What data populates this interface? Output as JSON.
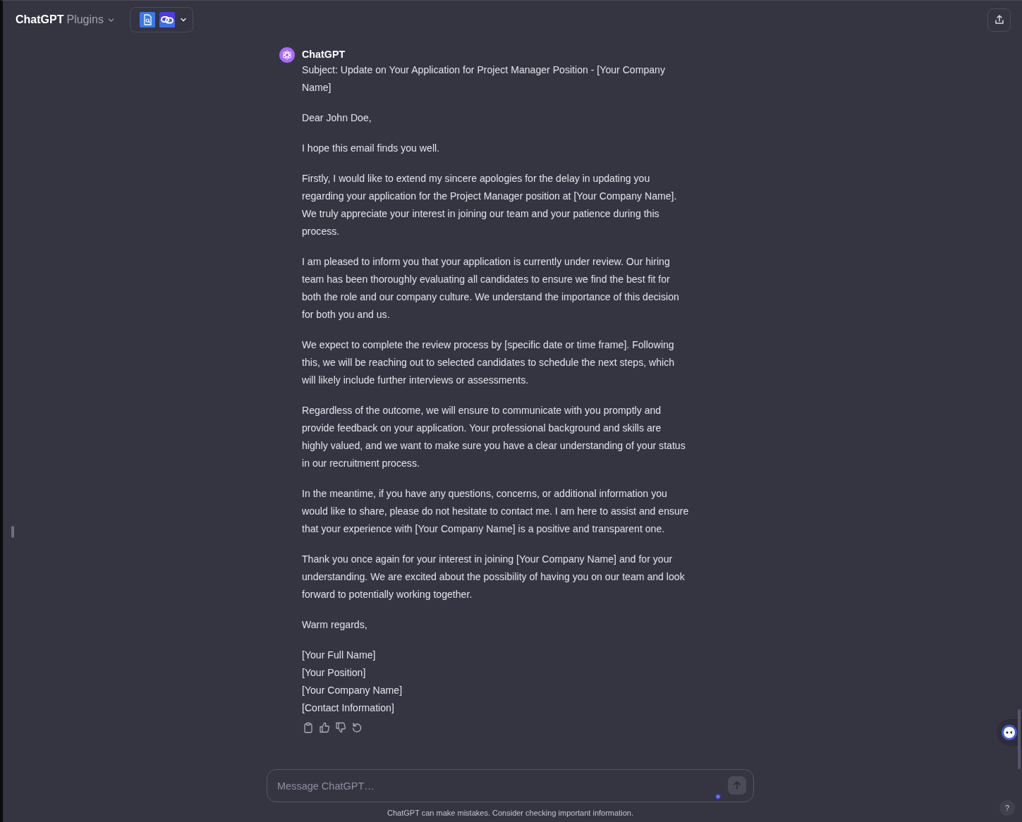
{
  "header": {
    "title": "ChatGPT",
    "model": "Plugins"
  },
  "message": {
    "author": "ChatGPT",
    "paragraphs": [
      "Subject: Update on Your Application for Project Manager Position - [Your Company Name]",
      "Dear John Doe,",
      "I hope this email finds you well.",
      "Firstly, I would like to extend my sincere apologies for the delay in updating you regarding your application for the Project Manager position at [Your Company Name]. We truly appreciate your interest in joining our team and your patience during this process.",
      "I am pleased to inform you that your application is currently under review. Our hiring team has been thoroughly evaluating all candidates to ensure we find the best fit for both the role and our company culture. We understand the importance of this decision for both you and us.",
      "We expect to complete the review process by [specific date or time frame]. Following this, we will be reaching out to selected candidates to schedule the next steps, which will likely include further interviews or assessments.",
      "Regardless of the outcome, we will ensure to communicate with you promptly and provide feedback on your application. Your professional background and skills are highly valued, and we want to make sure you have a clear understanding of your status in our recruitment process.",
      "In the meantime, if you have any questions, concerns, or additional information you would like to share, please do not hesitate to contact me. I am here to assist and ensure that your experience with [Your Company Name] is a positive and transparent one.",
      "Thank you once again for your interest in joining [Your Company Name] and for your understanding. We are excited about the possibility of having you on our team and look forward to potentially working together.",
      "Warm regards,"
    ],
    "signature": [
      "[Your Full Name]",
      "[Your Position]",
      "[Your Company Name]",
      "[Contact Information]"
    ]
  },
  "composer": {
    "placeholder": "Message ChatGPT…",
    "send_button": {
      "disabled": true
    }
  },
  "disclaimer": "ChatGPT can make mistakes. Consider checking important information.",
  "help_button": "?"
}
